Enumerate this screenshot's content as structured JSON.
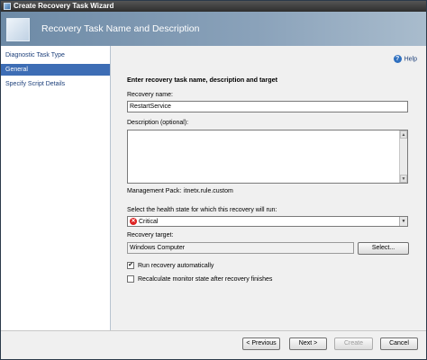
{
  "window": {
    "title": "Create Recovery Task Wizard"
  },
  "banner": {
    "title": "Recovery Task Name and Description"
  },
  "nav": {
    "items": [
      {
        "label": "Diagnostic Task Type"
      },
      {
        "label": "General"
      },
      {
        "label": "Specify Script Details"
      }
    ],
    "selected": "General"
  },
  "help": {
    "label": "Help"
  },
  "form": {
    "heading": "Enter recovery task name, description and target",
    "name_label": "Recovery name:",
    "name_value": "RestartService",
    "description_label": "Description (optional):",
    "description_value": "",
    "mp_label": "Management Pack:",
    "mp_value": "itnetx.rule.custom",
    "health_label": "Select the health state for which this recovery will run:",
    "health_value": "Critical",
    "target_label": "Recovery target:",
    "target_value": "Windows Computer",
    "select_button": "Select...",
    "run_auto_label": "Run recovery automatically",
    "run_auto_checked": true,
    "recalc_label": "Recalculate monitor state after recovery finishes",
    "recalc_checked": false
  },
  "footer": {
    "previous": "< Previous",
    "next": "Next >",
    "create": "Create",
    "cancel": "Cancel"
  }
}
